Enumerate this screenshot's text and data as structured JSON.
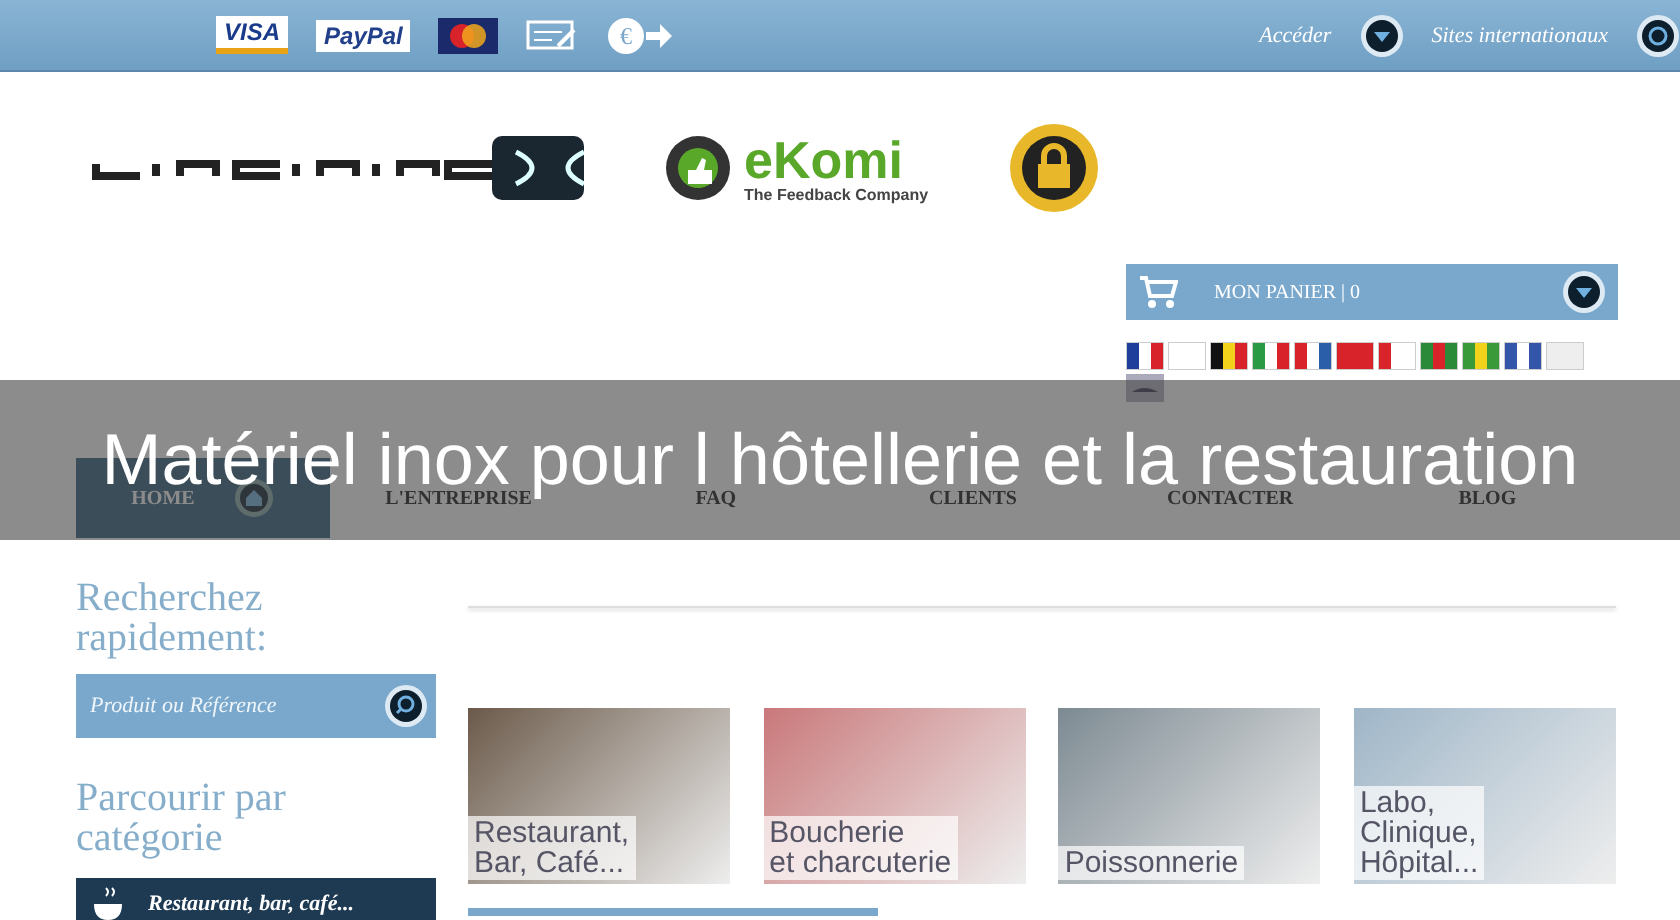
{
  "top_bar": {
    "payment_logos": [
      "VISA",
      "PayPal"
    ],
    "access_label": "Accéder",
    "international_label": "Sites internationaux"
  },
  "badges": {
    "ekomi_name": "eKomi",
    "ekomi_tagline": "The Feedback Company"
  },
  "euro_sign": "€",
  "cart": {
    "label": "MON PANIER",
    "separator": "|",
    "count": "0"
  },
  "overlay_title": "Matériel inox pour l hôtellerie et la restauration",
  "nav": [
    {
      "label": "HOME",
      "selected": true
    },
    {
      "label": "L'ENTREPRISE",
      "selected": false
    },
    {
      "label": "FAQ",
      "selected": false
    },
    {
      "label": "CLIENTS",
      "selected": false
    },
    {
      "label": "CONTACTER",
      "selected": false
    },
    {
      "label": "BLOG",
      "selected": false
    }
  ],
  "search": {
    "heading": "Recherchez rapidement:",
    "placeholder": "Produit ou Référence"
  },
  "browse": {
    "heading": "Parcourir par catégorie",
    "first_category": "Restaurant, bar, café..."
  },
  "categories": [
    {
      "caption": "Restaurant,\nBar, Café..."
    },
    {
      "caption": "Boucherie\net charcuterie"
    },
    {
      "caption": "Poissonnerie"
    },
    {
      "caption": "Labo,\nClinique,\nHôpital..."
    }
  ]
}
